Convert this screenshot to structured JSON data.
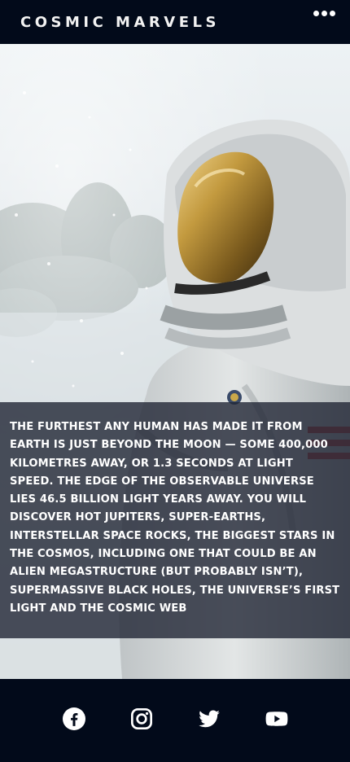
{
  "header": {
    "brand": "COSMIC MARVELS",
    "menu_icon": "more-horizontal-icon"
  },
  "hero": {
    "text": "THE FURTHEST ANY HUMAN HAS MADE IT FROM EARTH IS JUST BEYOND THE MOON — SOME 400,000 KILOMETRES AWAY, OR 1.3 SECONDS AT LIGHT SPEED. THE EDGE OF THE OBSERVABLE UNIVERSE LIES 46.5 BILLION LIGHT YEARS AWAY. YOU WILL DISCOVER HOT JUPITERS, SUPER-EARTHS, INTERSTELLAR SPACE ROCKS, THE BIGGEST STARS IN THE COSMOS, INCLUDING ONE THAT COULD BE AN ALIEN MEGASTRUCTURE (BUT PROBABLY ISN’T), SUPERMASSIVE BLACK HOLES, THE UNIVERSE’S FIRST LIGHT AND THE COSMIC WEB"
  },
  "footer": {
    "social": [
      {
        "icon": "facebook-icon"
      },
      {
        "icon": "instagram-icon"
      },
      {
        "icon": "twitter-icon"
      },
      {
        "icon": "youtube-icon"
      }
    ]
  },
  "colors": {
    "navy": "#020a1a",
    "overlay": "#212634",
    "text": "#ffffff"
  }
}
